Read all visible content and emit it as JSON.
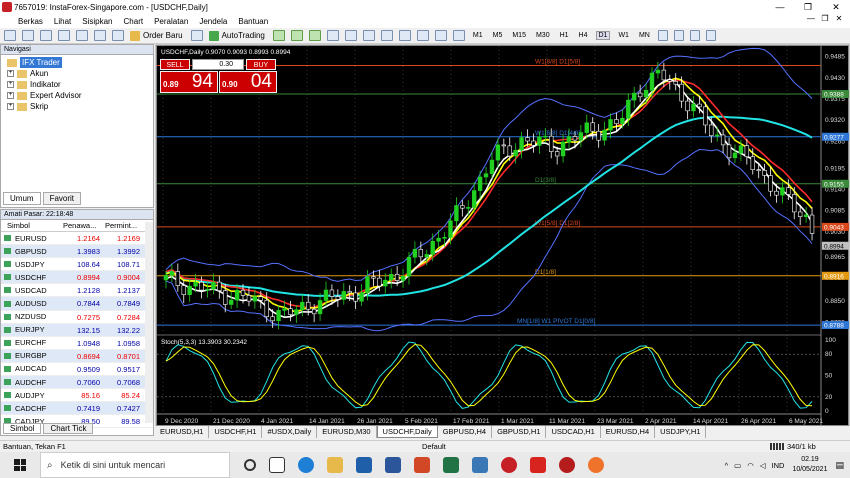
{
  "window": {
    "title": "7657019: InstaForex-Singapore.com - [USDCHF,Daily]",
    "buttons": [
      "—",
      "❐",
      "✕"
    ]
  },
  "menu": [
    "Berkas",
    "Lihat",
    "Sisipkan",
    "Chart",
    "Peralatan",
    "Jendela",
    "Bantuan"
  ],
  "mdi_buttons": [
    "—",
    "❐",
    "✕"
  ],
  "toolbar": {
    "order_label": "Order Baru",
    "autotrading_label": "AutoTrading",
    "timeframes": [
      "M1",
      "M5",
      "M15",
      "M30",
      "H1",
      "H4",
      "D1",
      "W1",
      "MN"
    ],
    "active_timeframe": "D1"
  },
  "navigator": {
    "title": "Navigasi",
    "items": [
      "IFX Trader",
      "Akun",
      "Indikator",
      "Expert Advisor",
      "Skrip"
    ],
    "tabs": [
      "Umum",
      "Favorit"
    ]
  },
  "market": {
    "title": "Amati Pasar: 22:18:48",
    "headers": [
      "Simbol",
      "Penawa...",
      "Permint..."
    ],
    "rows": [
      {
        "sym": "EURUSD",
        "bid": "1.2164",
        "ask": "1.2169"
      },
      {
        "sym": "GBPUSD",
        "bid": "1.3983",
        "ask": "1.3992"
      },
      {
        "sym": "USDJPY",
        "bid": "108.64",
        "ask": "108.71"
      },
      {
        "sym": "USDCHF",
        "bid": "0.8994",
        "ask": "0.9004"
      },
      {
        "sym": "USDCAD",
        "bid": "1.2128",
        "ask": "1.2137"
      },
      {
        "sym": "AUDUSD",
        "bid": "0.7844",
        "ask": "0.7849"
      },
      {
        "sym": "NZDUSD",
        "bid": "0.7275",
        "ask": "0.7284"
      },
      {
        "sym": "EURJPY",
        "bid": "132.15",
        "ask": "132.22"
      },
      {
        "sym": "EURCHF",
        "bid": "1.0948",
        "ask": "1.0958"
      },
      {
        "sym": "EURGBP",
        "bid": "0.8694",
        "ask": "0.8701"
      },
      {
        "sym": "AUDCAD",
        "bid": "0.9509",
        "ask": "0.9517"
      },
      {
        "sym": "AUDCHF",
        "bid": "0.7060",
        "ask": "0.7068"
      },
      {
        "sym": "AUDJPY",
        "bid": "85.16",
        "ask": "85.24"
      },
      {
        "sym": "CADCHF",
        "bid": "0.7419",
        "ask": "0.7427"
      },
      {
        "sym": "CADJPY",
        "bid": "89.50",
        "ask": "89.58"
      }
    ],
    "tabs": [
      "Simbol",
      "Chart Tick"
    ]
  },
  "trade": {
    "sell": "SELL",
    "buy": "BUY",
    "lot": "0.30",
    "sell_small": "0.89",
    "sell_big": "94",
    "buy_small": "0.90",
    "buy_big": "04"
  },
  "chart": {
    "header": "USDCHF,Daily  0.9070 0.9093 0.8993 0.8994",
    "stoch_label": "Stoch(5,3,3) 13.3903 30.2342",
    "price_axis": [
      "0.9485",
      "0.9430",
      "0.9375",
      "0.9320",
      "0.9265",
      "0.9195",
      "0.9140",
      "0.9085",
      "0.9030",
      "0.8965",
      "0.8910",
      "0.8850",
      "0.8795"
    ],
    "highlight_labels": [
      {
        "text": "0.9388",
        "color": "#3a8a3a"
      },
      {
        "text": "0.9277",
        "color": "#2f77d6"
      },
      {
        "text": "0.9155",
        "color": "#3a8a3a"
      },
      {
        "text": "0.9043",
        "color": "#d8481b"
      },
      {
        "text": "0.8994",
        "color": "#c0c0c0"
      },
      {
        "text": "0.8916",
        "color": "#e39a13"
      },
      {
        "text": "0.8788",
        "color": "#2f77d6"
      }
    ],
    "levels": [
      {
        "name": "W1[8/8] D1[5/8]",
        "value": 0.9462,
        "color": "#d8481b"
      },
      {
        "name": "",
        "value": 0.9388,
        "color": "#3a8a3a"
      },
      {
        "name": "W1[6/8] D1[4/8]",
        "value": 0.9277,
        "color": "#2f77d6"
      },
      {
        "name": "D1[3/8]",
        "value": 0.9155,
        "color": "#3a8a3a"
      },
      {
        "name": "W1[5/8] D1[2/8]",
        "value": 0.9043,
        "color": "#d8481b"
      },
      {
        "name": "D1[1/8]",
        "value": 0.8916,
        "color": "#e39a13"
      },
      {
        "name": "MN[1/8] W1 PIVOT D1[0/8]",
        "value": 0.8788,
        "color": "#2f77d6"
      }
    ],
    "stoch_axis": [
      "100",
      "80",
      "50",
      "20",
      "0"
    ],
    "date_labels": [
      "9 Dec 2020",
      "21 Dec 2020",
      "4 Jan 2021",
      "14 Jan 2021",
      "26 Jan 2021",
      "5 Feb 2021",
      "17 Feb 2021",
      "1 Mar 2021",
      "11 Mar 2021",
      "23 Mar 2021",
      "2 Apr 2021",
      "14 Apr 2021",
      "26 Apr 2021",
      "6 May 2021"
    ]
  },
  "chart_tabs": [
    "EURUSD,H1",
    "USDCHF,H1",
    "#USDX,Daily",
    "EURUSD,M30",
    "USDCHF,Daily",
    "GBPUSD,H4",
    "GBPUSD,H1",
    "USDCAD,H1",
    "EURUSD,H4",
    "USDJPY,H1"
  ],
  "active_chart_tab": "USDCHF,Daily",
  "status": {
    "help": "Bantuan, Tekan F1",
    "profile": "Default",
    "traffic": "340/1 kb"
  },
  "taskbar": {
    "search_placeholder": "Ketik di sini untuk mencari",
    "lang": "IND",
    "time": "02.19",
    "date": "10/05/2021"
  },
  "colors": {
    "candle_up": "#21d021",
    "candle_down": "#ffffff",
    "ma_red": "#ff2a2a",
    "ma_yellow": "#ffff00",
    "ma_white": "#ffffff",
    "ma_cyan": "#22e3e3",
    "bollinger": "#5470ff"
  }
}
